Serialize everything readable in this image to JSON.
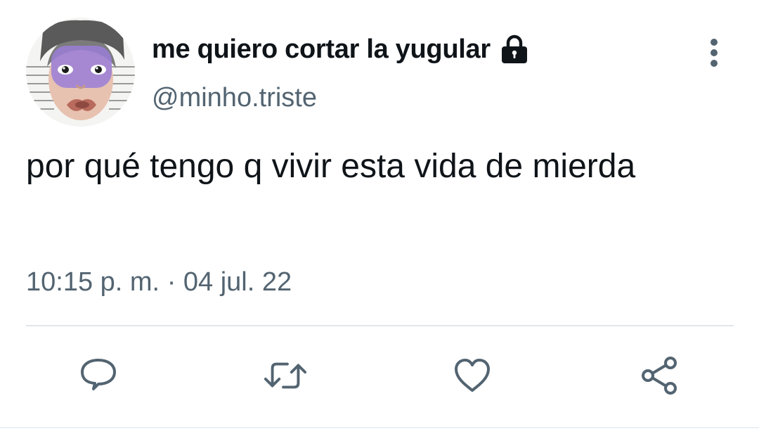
{
  "profile": {
    "display_name": "me quiero cortar la yugular",
    "handle": "@minho.triste",
    "avatar_icon": "avatar-photo",
    "protected_icon": "lock-icon"
  },
  "tweet": {
    "text": "por qué tengo q vivir esta vida de mierda",
    "time": "10:15 p. m.",
    "separator": "·",
    "date": "04 jul. 22"
  },
  "actions": {
    "reply_icon": "comment-icon",
    "retweet_icon": "retweet-icon",
    "like_icon": "heart-icon",
    "share_icon": "share-icon",
    "more_icon": "more-vertical-icon"
  },
  "colors": {
    "text": "#0f1419",
    "secondary": "#536471",
    "divider": "#e1e6ea"
  }
}
